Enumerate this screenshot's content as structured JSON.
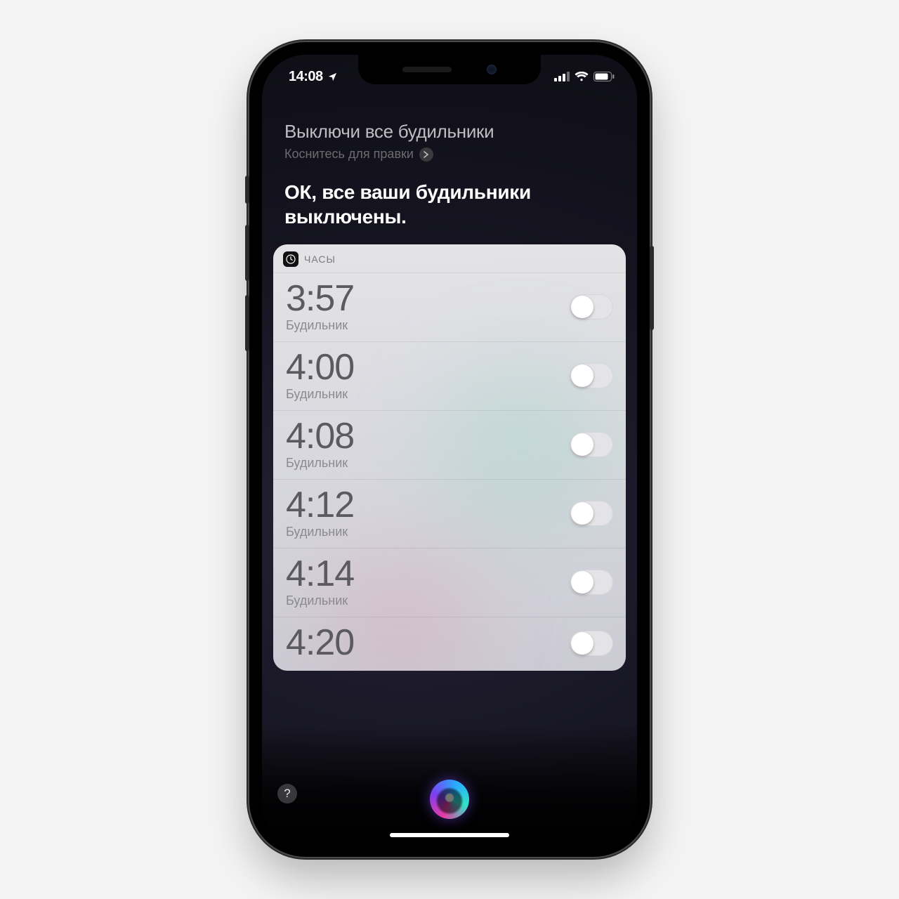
{
  "statusbar": {
    "time": "14:08"
  },
  "siri": {
    "user_query": "Выключи все будильники",
    "edit_hint": "Коснитесь для правки",
    "response": "ОК, все ваши будильники выключены."
  },
  "card": {
    "title": "ЧАСЫ",
    "alarms": [
      {
        "time": "3:57",
        "label": "Будильник",
        "on": false
      },
      {
        "time": "4:00",
        "label": "Будильник",
        "on": false
      },
      {
        "time": "4:08",
        "label": "Будильник",
        "on": false
      },
      {
        "time": "4:12",
        "label": "Будильник",
        "on": false
      },
      {
        "time": "4:14",
        "label": "Будильник",
        "on": false
      },
      {
        "time": "4:20",
        "label": "",
        "on": false
      }
    ]
  },
  "help_label": "?"
}
